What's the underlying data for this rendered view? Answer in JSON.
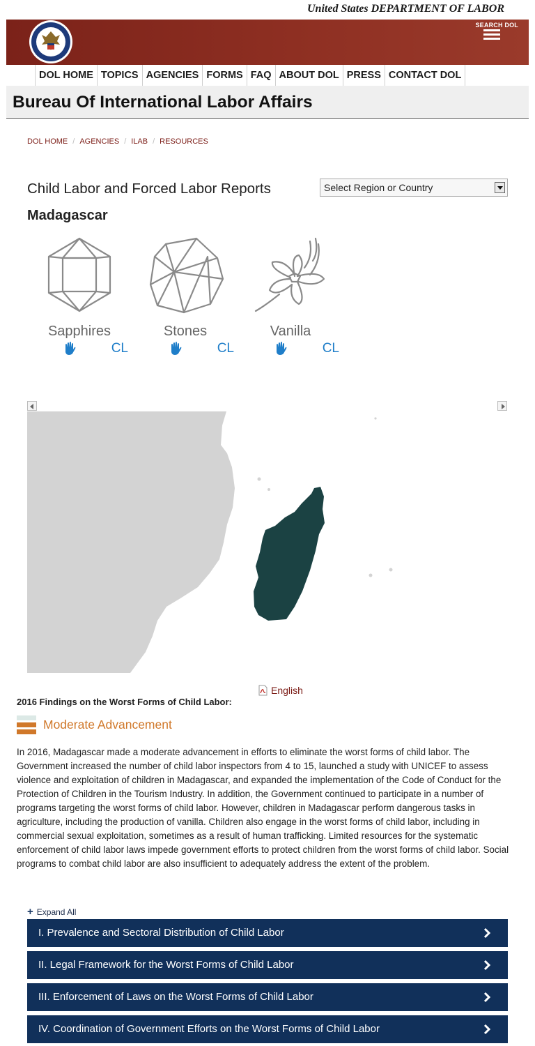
{
  "header": {
    "department": "United States DEPARTMENT OF LABOR",
    "search_label": "SEARCH DOL",
    "icons": {
      "seal": "dol-seal-icon",
      "menu": "hamburger-menu-icon"
    },
    "colors": {
      "banner": "#8e2f22",
      "nav_text": "#1b1b1b"
    }
  },
  "nav": {
    "items": [
      {
        "label": "DOL HOME"
      },
      {
        "label": "TOPICS"
      },
      {
        "label": "AGENCIES"
      },
      {
        "label": "FORMS"
      },
      {
        "label": "FAQ"
      },
      {
        "label": "ABOUT DOL"
      },
      {
        "label": "PRESS"
      },
      {
        "label": "CONTACT DOL"
      }
    ]
  },
  "bureau": {
    "title": "Bureau Of International Labor Affairs"
  },
  "breadcrumb": [
    {
      "label": "DOL HOME"
    },
    {
      "label": "AGENCIES"
    },
    {
      "label": "ILAB"
    },
    {
      "label": "RESOURCES"
    }
  ],
  "report": {
    "title": "Child Labor and Forced Labor Reports",
    "select_value": "Select Region or Country",
    "country": "Madagascar"
  },
  "goods": [
    {
      "name": "Sapphires",
      "tag": "CL",
      "icon": "sapphire-gem-icon"
    },
    {
      "name": "Stones",
      "tag": "CL",
      "icon": "stone-icon"
    },
    {
      "name": "Vanilla",
      "tag": "CL",
      "icon": "vanilla-flower-icon"
    }
  ],
  "tag_icon": "raised-hand-icon",
  "map": {
    "highlight_color": "#1b4243",
    "land_color": "#d3d3d3"
  },
  "findings": {
    "english_link": "English",
    "title": "2016 Findings on the Worst Forms of Child Labor:",
    "assessment": "Moderate Advancement",
    "assessment_color": "#d0782a",
    "summary": "In 2016, Madagascar made a moderate advancement in efforts to eliminate the worst forms of child labor. The Government increased the number of child labor inspectors from 4 to 15, launched a study with UNICEF to assess violence and exploitation of children in Madagascar, and expanded the implementation of the Code of Conduct for the Protection of Children in the Tourism Industry. In addition, the Government continued to participate in a number of programs targeting the worst forms of child labor. However, children in Madagascar perform dangerous tasks in agriculture, including the production of vanilla. Children also engage in the worst forms of child labor, including in commercial sexual exploitation, sometimes as a result of human trafficking. Limited resources for the systematic enforcement of child labor laws impede government efforts to protect children from the worst forms of child labor. Social programs to combat child labor are also insufficient to adequately address the extent of the problem."
  },
  "expand_all": "Expand All",
  "sections": [
    {
      "label": "I. Prevalence and Sectoral Distribution of Child Labor"
    },
    {
      "label": "II. Legal Framework for the Worst Forms of Child Labor"
    },
    {
      "label": "III. Enforcement of Laws on the Worst Forms of Child Labor"
    },
    {
      "label": "IV. Coordination of Government Efforts on the Worst Forms of Child Labor"
    }
  ],
  "accordion_color": "#11305a"
}
